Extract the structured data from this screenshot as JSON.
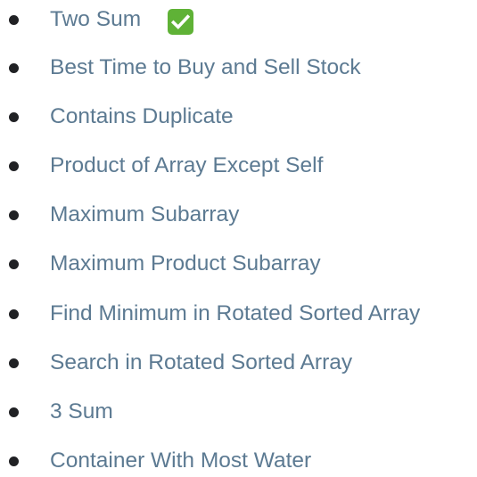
{
  "problems": [
    {
      "label": "Two Sum",
      "completed": true,
      "icon": "check-mark-icon"
    },
    {
      "label": "Best Time to Buy and Sell Stock",
      "completed": false
    },
    {
      "label": "Contains Duplicate",
      "completed": false
    },
    {
      "label": "Product of Array Except Self",
      "completed": false
    },
    {
      "label": "Maximum Subarray",
      "completed": false
    },
    {
      "label": "Maximum Product Subarray",
      "completed": false
    },
    {
      "label": "Find Minimum in Rotated Sorted Array",
      "completed": false
    },
    {
      "label": "Search in Rotated Sorted Array",
      "completed": false
    },
    {
      "label": "3 Sum",
      "completed": false
    },
    {
      "label": "Container With Most Water",
      "completed": false
    }
  ],
  "colors": {
    "link": "#5c7a92",
    "bullet": "#202124",
    "check_background": "#5fb236",
    "check_mark": "#ffffff"
  }
}
